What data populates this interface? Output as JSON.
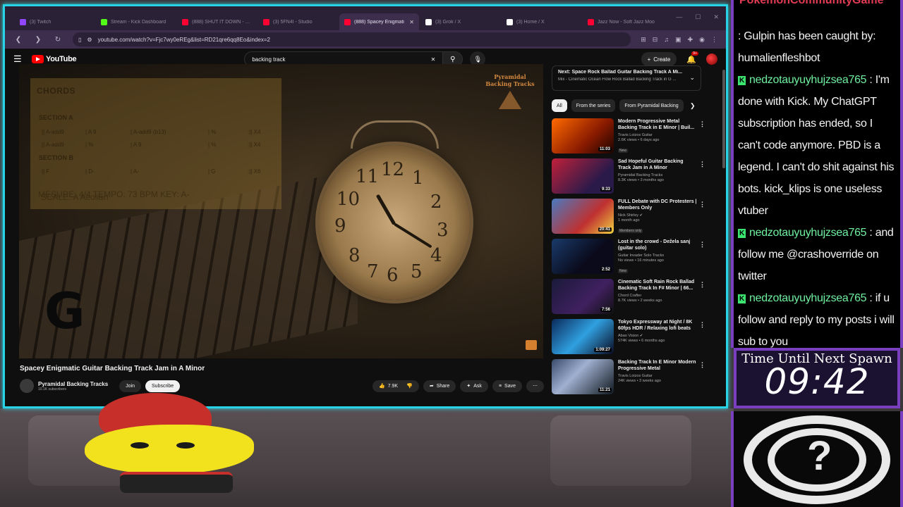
{
  "browser": {
    "tabs": [
      {
        "title": "(3) Twitch",
        "color": "#9146ff",
        "active": false
      },
      {
        "title": "Stream - Kick Dashboard",
        "color": "#53fc18",
        "active": false
      },
      {
        "title": "(888) SHUT IT DOWN - YouTu",
        "color": "#ff0033",
        "active": false
      },
      {
        "title": "(3) 5FN4I - Studio",
        "color": "#ff0033",
        "active": false
      },
      {
        "title": "(888) Spacey Enigmati",
        "color": "#ff0033",
        "active": true
      },
      {
        "title": "(3) Grok / X",
        "color": "#ffffff",
        "active": false
      },
      {
        "title": "(3) Home / X",
        "color": "#ffffff",
        "active": false
      },
      {
        "title": "Jazz Now - Soft Jazz Moo",
        "color": "#ff0033",
        "active": false
      }
    ],
    "url": "youtube.com/watch?v=Fjc7wy0eREg&list=RD21qre6qq8Eo&index=2"
  },
  "youtube": {
    "logo_text": "YouTube",
    "search_query": "backing track",
    "create_label": "Create",
    "notif_count": "9+",
    "player": {
      "chords_title": "CHORDS",
      "section_a": "SECTION A",
      "section_a_line1": [
        "|| A-add9",
        "| A 9",
        "| A-add9 (b13)",
        "| %",
        ":|| X4"
      ],
      "section_a_line2": [
        "|| A-add9",
        "| %",
        "| A 9",
        "| %",
        ":|| X4"
      ],
      "section_b": "SECTION B",
      "section_b_line1": [
        "|| F",
        "| D-",
        "| A-",
        "| G",
        ":|| X6"
      ],
      "meta_line": "MESURE: 4/4       TEMPO: 73 BPM        KEY: A-",
      "scale_line": "SCALE: A Aeolian",
      "current_chord": "G",
      "watermark_top": "Pyramidal",
      "watermark_bottom": "Backing Tracks"
    },
    "video_title": "Spacey Enigmatic Guitar Backing Track Jam in A Minor",
    "channel_name": "Pyramidal Backing Tracks",
    "channel_subs": "10.1K subscribers",
    "join_label": "Join",
    "subscribe_label": "Subscribe",
    "like_count": "7.9K",
    "share_label": "Share",
    "ask_label": "Ask",
    "save_label": "Save",
    "up_next": {
      "title": "Next: Space Rock Ballad Guitar Backing Track A Mi...",
      "subtitle": "Mix - Cinematic Ocean Flow Rock Ballad Backing Track in G ..."
    },
    "chips": [
      "All",
      "From the series",
      "From Pyramidal Backing"
    ],
    "recommendations": [
      {
        "title": "Modern Progressive Metal Backing Track in E Minor | Buil...",
        "channel": "Travis Loizos Guitar",
        "stats": "2.6K views • 6 days ago",
        "badge": "New",
        "duration": "11:03",
        "thumb": "linear-gradient(135deg,#ff6a00,#8a1a00 60%,#1a0500)"
      },
      {
        "title": "Sad Hopeful Guitar Backing Track Jam in A Minor",
        "channel": "Pyramidal Backing Tracks",
        "stats": "8.3K views • 3 months ago",
        "badge": "",
        "duration": "9:33",
        "thumb": "linear-gradient(135deg,#c0203a,#2a1a4a 70%)"
      },
      {
        "title": "FULL Debate with DC Protesters | Members Only",
        "channel": "Nick Shirley ✔",
        "stats": "1 month ago",
        "badge": "Members only",
        "duration": "20:41",
        "thumb": "linear-gradient(135deg,#4a7ac0,#c03030 60%,#f0d040)"
      },
      {
        "title": "Lost in the crowd - Dežela sanj (guitar solo)",
        "channel": "Guitar Invader Solo Tracks",
        "stats": "No views • 16 minutes ago",
        "badge": "New",
        "duration": "2:52",
        "thumb": "linear-gradient(135deg,#1a3a6a,#0a0a1a 60%)"
      },
      {
        "title": "Cinematic Soft Rain Rock Ballad Backing Track In F# Minor | 66...",
        "channel": "Chord Crafter",
        "stats": "8.7K views • 2 weeks ago",
        "badge": "",
        "duration": "7:56",
        "thumb": "linear-gradient(135deg,#1a1a3a,#402060 60%,#101010)"
      },
      {
        "title": "Tokyo Expressway at Night / 8K 60fps HDR / Relaxing lofi beats",
        "channel": "Abao Vision ✔",
        "stats": "574K views • 6 months ago",
        "badge": "",
        "duration": "1:09:27",
        "thumb": "linear-gradient(135deg,#0a2a5a,#30a0e0 50%,#0a0a20)"
      },
      {
        "title": "Backing Track In E Minor Modern Progressive Metal",
        "channel": "Travis Loizos Guitar",
        "stats": "24K views • 3 weeks ago",
        "badge": "",
        "duration": "11:21",
        "thumb": "linear-gradient(135deg,#3a4a6a,#a0b0d0 40%,#101820)"
      }
    ]
  },
  "chat": {
    "cut_text": "PokemonCommunityGame",
    "messages": [
      {
        "kick": false,
        "user": "",
        "text": ": Gulpin has been caught by: humalienfleshbot"
      },
      {
        "kick": true,
        "user": "nedzotauyuyhujzsea765",
        "text": " : I'm done with Kick. My ChatGPT subscription has ended, so I can't code anymore. PBD is a legend. I can't do shit against his bots. kick_klips is one useless vtuber"
      },
      {
        "kick": true,
        "user": "nedzotauyuyhujzsea765",
        "text": " : and follow me @crashoverride on twitter"
      },
      {
        "kick": true,
        "user": "nedzotauyuyhujzsea765",
        "text": " : if u follow and reply to my posts i will sub to you"
      }
    ]
  },
  "timer": {
    "label": "Time Until Next Spawn",
    "value": "09:42"
  },
  "colors": {
    "browser_border": "#29d3e6",
    "stream_border": "#7a3fbf",
    "kick_green": "#3be36f",
    "yt_red": "#ff0000"
  }
}
